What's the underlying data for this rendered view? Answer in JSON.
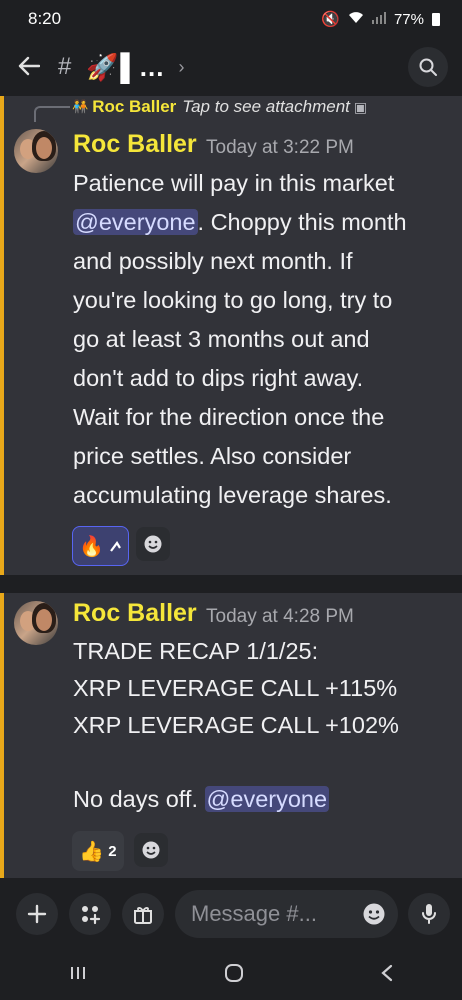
{
  "status": {
    "time": "8:20",
    "battery": "77%"
  },
  "header": {
    "channel_emoji": "🚀",
    "channel_name": "▌...",
    "chevron": "›"
  },
  "reply_preview": {
    "author": "Roc Baller",
    "text": "Tap to see attachment"
  },
  "messages": [
    {
      "author": "Roc Baller",
      "timestamp": "Today at 3:22 PM",
      "lines": [
        [
          "Patience will pay in this market",
          ""
        ],
        [
          "@everyone",
          ". Choppy this month"
        ],
        [
          "and possibly next month. If",
          ""
        ],
        [
          "you're looking to go long, try to",
          ""
        ],
        [
          "go at least 3 months out and",
          ""
        ],
        [
          "don't add to dips right away.",
          ""
        ],
        [
          "Wait for the direction once the",
          ""
        ],
        [
          "price settles. Also consider",
          ""
        ],
        [
          "accumulating leverage shares.",
          ""
        ]
      ],
      "reaction": {
        "emoji": "🔥",
        "count": ""
      }
    },
    {
      "author": "Roc Baller",
      "timestamp": "Today at 4:28 PM",
      "lines": [
        "TRADE RECAP 1/1/25:",
        "XRP LEVERAGE CALL +115%",
        "XRP LEVERAGE CALL +102%",
        "",
        "No days off."
      ],
      "mention": "@everyone",
      "reaction": {
        "emoji": "👍",
        "count": "2"
      }
    }
  ],
  "composer": {
    "placeholder": "Message #..."
  },
  "colors": {
    "accent": "#5865f2",
    "author": "#f5e63a",
    "gutter": "#e8a81a"
  }
}
